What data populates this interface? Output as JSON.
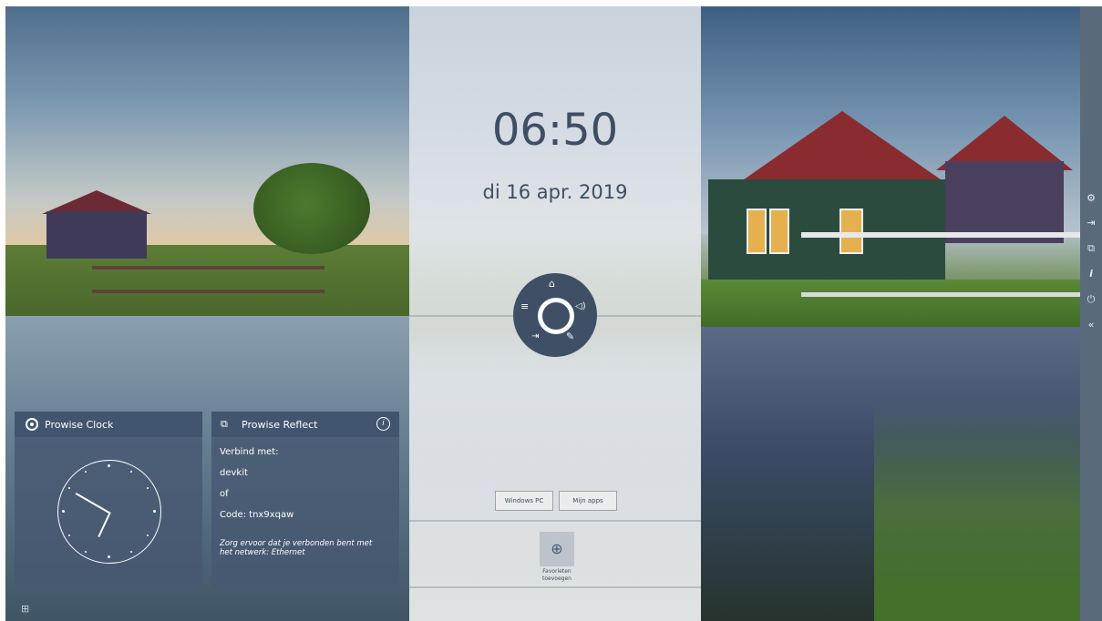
{
  "clock": {
    "time": "06:50",
    "date": "di 16 apr. 2019"
  },
  "radial_menu": {
    "icons": [
      "home-icon",
      "menu-icon",
      "volume-icon",
      "input-source-icon",
      "pen-icon"
    ]
  },
  "launcher": {
    "buttons": [
      "Windows PC",
      "Mijn apps"
    ],
    "favorites_label_line1": "Favorieten",
    "favorites_label_line2": "toevoegen"
  },
  "widgets": {
    "clock_title": "Prowise Clock",
    "analog_time": {
      "hour": 6,
      "minute": 50
    },
    "reflect_title": "Prowise Reflect",
    "connect_label": "Verbind met:",
    "device_name": "devkit",
    "or_label": "of",
    "code_label": "Code: tnx9xqaw",
    "network_note": "Zorg ervoor dat je verbonden bent met het netwerk: Ethernet"
  },
  "sidebar": {
    "icons": [
      "settings-icon",
      "input-source-icon",
      "screen-share-icon",
      "info-icon",
      "power-icon",
      "collapse-icon"
    ]
  },
  "colors": {
    "accent_dark": "#3f4f66",
    "text_dark": "#3e4e63",
    "widget_bg": "#465870",
    "sidebar_bg": "#5a6a7b"
  }
}
